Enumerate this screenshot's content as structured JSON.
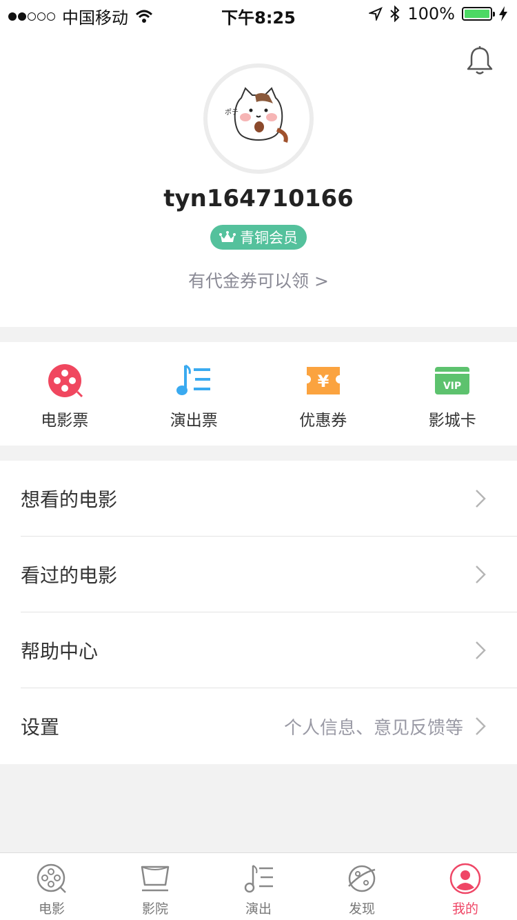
{
  "status_bar": {
    "carrier": "中国移动",
    "time": "下午8:25",
    "battery": "100%"
  },
  "profile": {
    "username": "tyn164710166",
    "member_level": "青铜会员",
    "coupon_link": "有代金券可以领 >"
  },
  "quick_actions": [
    {
      "label": "电影票",
      "icon": "film-reel-icon",
      "color": "#f0475f"
    },
    {
      "label": "演出票",
      "icon": "music-note-icon",
      "color": "#3aaaf0"
    },
    {
      "label": "优惠券",
      "icon": "yen-ticket-icon",
      "color": "#fba33f"
    },
    {
      "label": "影城卡",
      "icon": "vip-card-icon",
      "color": "#5dc26e"
    }
  ],
  "menu": [
    {
      "label": "想看的电影",
      "hint": ""
    },
    {
      "label": "看过的电影",
      "hint": ""
    },
    {
      "label": "帮助中心",
      "hint": ""
    },
    {
      "label": "设置",
      "hint": "个人信息、意见反馈等"
    }
  ],
  "tabs": [
    {
      "label": "电影",
      "icon": "film-reel-icon",
      "active": false
    },
    {
      "label": "影院",
      "icon": "cinema-screen-icon",
      "active": false
    },
    {
      "label": "演出",
      "icon": "music-note-icon",
      "active": false
    },
    {
      "label": "发现",
      "icon": "planet-icon",
      "active": false
    },
    {
      "label": "我的",
      "icon": "user-icon",
      "active": true
    }
  ],
  "colors": {
    "accent": "#ef4666",
    "member_badge": "#54c19c"
  }
}
